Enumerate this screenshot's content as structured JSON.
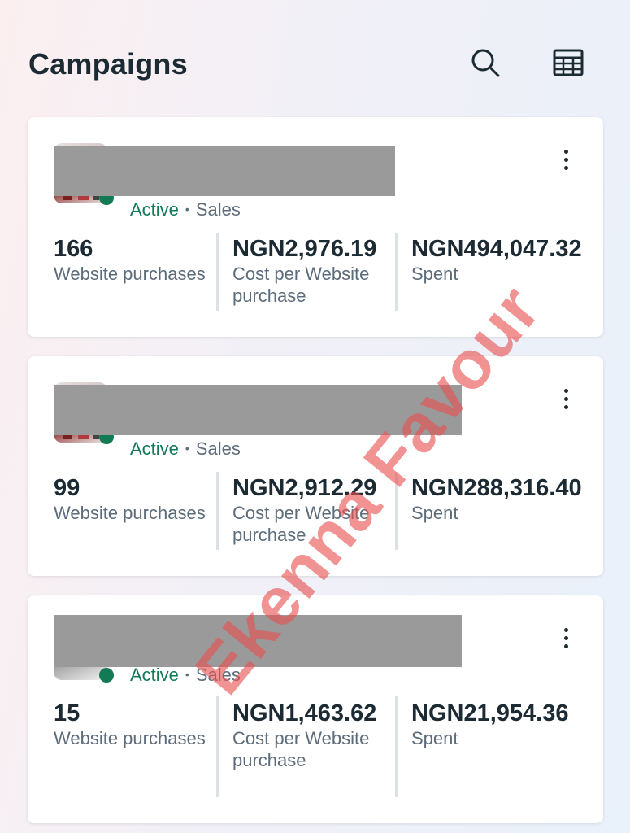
{
  "header": {
    "title": "Campaigns",
    "search_icon": "search-icon",
    "columns_icon": "table-columns-icon"
  },
  "campaigns": [
    {
      "status": "Active",
      "objective": "Sales",
      "metrics": [
        {
          "value": "166",
          "label": "Website purchases"
        },
        {
          "value": "NGN2,976.19",
          "label": "Cost per Website purchase"
        },
        {
          "value": "NGN494,047.32",
          "label": "Spent"
        }
      ]
    },
    {
      "status": "Active",
      "objective": "Sales",
      "metrics": [
        {
          "value": "99",
          "label": "Website purchases"
        },
        {
          "value": "NGN2,912.29",
          "label": "Cost per Website purchase"
        },
        {
          "value": "NGN288,316.40",
          "label": "Spent"
        }
      ]
    },
    {
      "status": "Active",
      "objective": "Sales",
      "metrics": [
        {
          "value": "15",
          "label": "Website purchases"
        },
        {
          "value": "NGN1,463.62",
          "label": "Cost per Website purchase"
        },
        {
          "value": "NGN21,954.36",
          "label": "Spent"
        }
      ]
    }
  ],
  "separator": "•",
  "watermark": "Ekenna Favour",
  "colors": {
    "active_green": "#127a55",
    "text_primary": "#1c2b33",
    "text_secondary": "#5d6c7b",
    "watermark_red": "#e85050"
  }
}
